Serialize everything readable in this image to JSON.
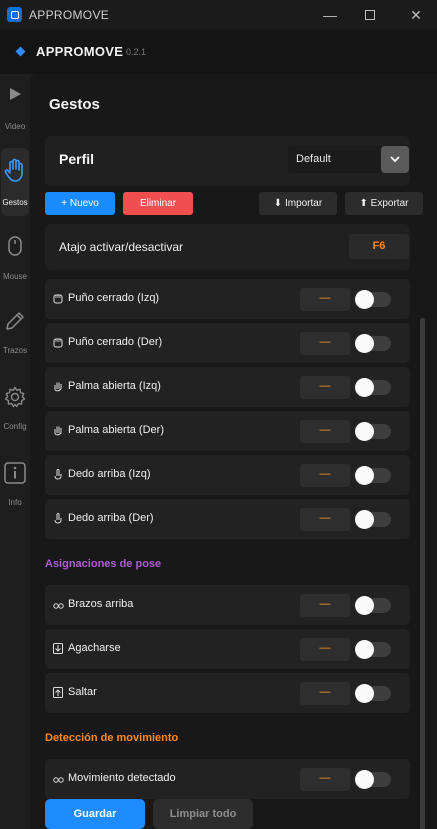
{
  "window": {
    "title": "APPROMOVE",
    "controls": {
      "minimize": "—",
      "maximize": "☐",
      "close": "✕"
    }
  },
  "app": {
    "name": "APPROMOVE",
    "version": "0.2.1"
  },
  "sidebar": {
    "items": [
      {
        "label": "Video",
        "icon": "play-icon",
        "active": false
      },
      {
        "label": "Gestos",
        "icon": "hand-icon",
        "active": true
      },
      {
        "label": "Mouse",
        "icon": "mouse-icon",
        "active": false
      },
      {
        "label": "Trazos",
        "icon": "pencil-icon",
        "active": false
      },
      {
        "label": "Config",
        "icon": "gear-icon",
        "active": false
      },
      {
        "label": "Info",
        "icon": "info-icon",
        "active": false
      }
    ]
  },
  "page": {
    "title": "Gestos",
    "profile": {
      "label": "Perfil",
      "selected": "Default",
      "buttons": {
        "new": "+ Nuevo",
        "delete": "Eliminar",
        "import": "⬇ Importar",
        "export": "⬆ Exportar"
      }
    },
    "shortcut": {
      "label": "Atajo activar/desactivar",
      "key": "F6"
    },
    "gestures": [
      {
        "label": "Puño cerrado (Izq)",
        "key": "—",
        "enabled": false,
        "icon": "fist-icon"
      },
      {
        "label": "Puño cerrado (Der)",
        "key": "—",
        "enabled": false,
        "icon": "fist-icon"
      },
      {
        "label": "Palma abierta (Izq)",
        "key": "—",
        "enabled": false,
        "icon": "palm-icon"
      },
      {
        "label": "Palma abierta (Der)",
        "key": "—",
        "enabled": false,
        "icon": "palm-icon"
      },
      {
        "label": "Dedo arriba (Izq)",
        "key": "—",
        "enabled": false,
        "icon": "finger-up-icon"
      },
      {
        "label": "Dedo arriba (Der)",
        "key": "—",
        "enabled": false,
        "icon": "finger-up-icon"
      }
    ],
    "pose_section": {
      "title": "Asignaciones de pose",
      "color": "#b05bd6",
      "items": [
        {
          "label": "Brazos arriba",
          "key": "—",
          "enabled": false,
          "icon": "arms-up-icon"
        },
        {
          "label": "Agacharse",
          "key": "—",
          "enabled": false,
          "icon": "arrow-down-icon"
        },
        {
          "label": "Saltar",
          "key": "—",
          "enabled": false,
          "icon": "arrow-up-icon"
        }
      ]
    },
    "motion_section": {
      "title": "Detección de movimiento",
      "color": "#ff8a1f",
      "items": [
        {
          "label": "Movimiento detectado",
          "key": "—",
          "enabled": false,
          "icon": "motion-icon"
        }
      ]
    },
    "footer": {
      "save": "Guardar",
      "clear": "Limpiar todo"
    }
  },
  "colors": {
    "accent": "#1a8cff",
    "danger": "#ef4f4f",
    "key": "#ff8a1f"
  }
}
